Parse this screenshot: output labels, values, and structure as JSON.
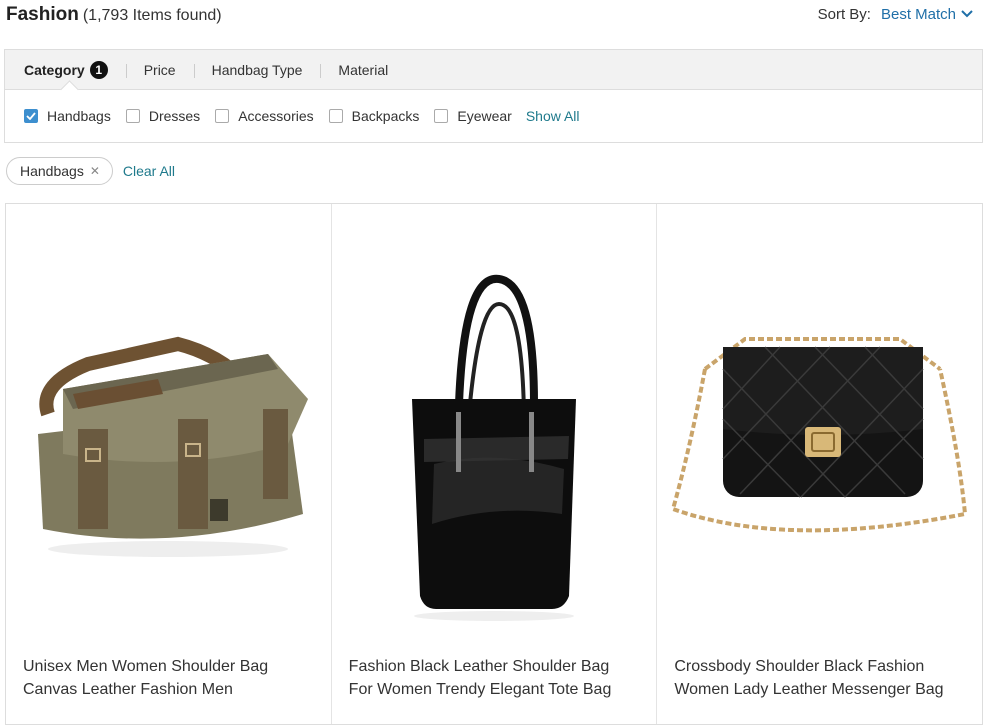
{
  "header": {
    "title": "Fashion",
    "count": "(1,793 Items found)",
    "sort_label": "Sort By:",
    "sort_value": "Best Match"
  },
  "filter_tabs": [
    {
      "label": "Category",
      "badge": "1",
      "active": true
    },
    {
      "label": "Price"
    },
    {
      "label": "Handbag Type"
    },
    {
      "label": "Material"
    }
  ],
  "category_options": [
    {
      "label": "Handbags",
      "checked": true
    },
    {
      "label": "Dresses",
      "checked": false
    },
    {
      "label": "Accessories",
      "checked": false
    },
    {
      "label": "Backpacks",
      "checked": false
    },
    {
      "label": "Eyewear",
      "checked": false
    }
  ],
  "show_all": "Show All",
  "active_filters": {
    "chips": [
      "Handbags"
    ],
    "clear_all": "Clear All"
  },
  "products": [
    {
      "name_line1": "Unisex Men Women Shoulder Bag",
      "name_line2": "Canvas Leather Fashion Men",
      "image": "canvas-messenger-bag-image"
    },
    {
      "name_line1": "Fashion Black Leather Shoulder Bag",
      "name_line2": "For Women Trendy Elegant Tote Bag",
      "image": "black-leather-tote-image"
    },
    {
      "name_line1": "Crossbody Shoulder Black Fashion",
      "name_line2": "Women Lady Leather Messenger Bag",
      "image": "quilted-chain-bag-image"
    }
  ],
  "colors": {
    "link": "#1f7a8c",
    "sort_link": "#1f6fa8",
    "checkbox": "#3d8fcf"
  }
}
